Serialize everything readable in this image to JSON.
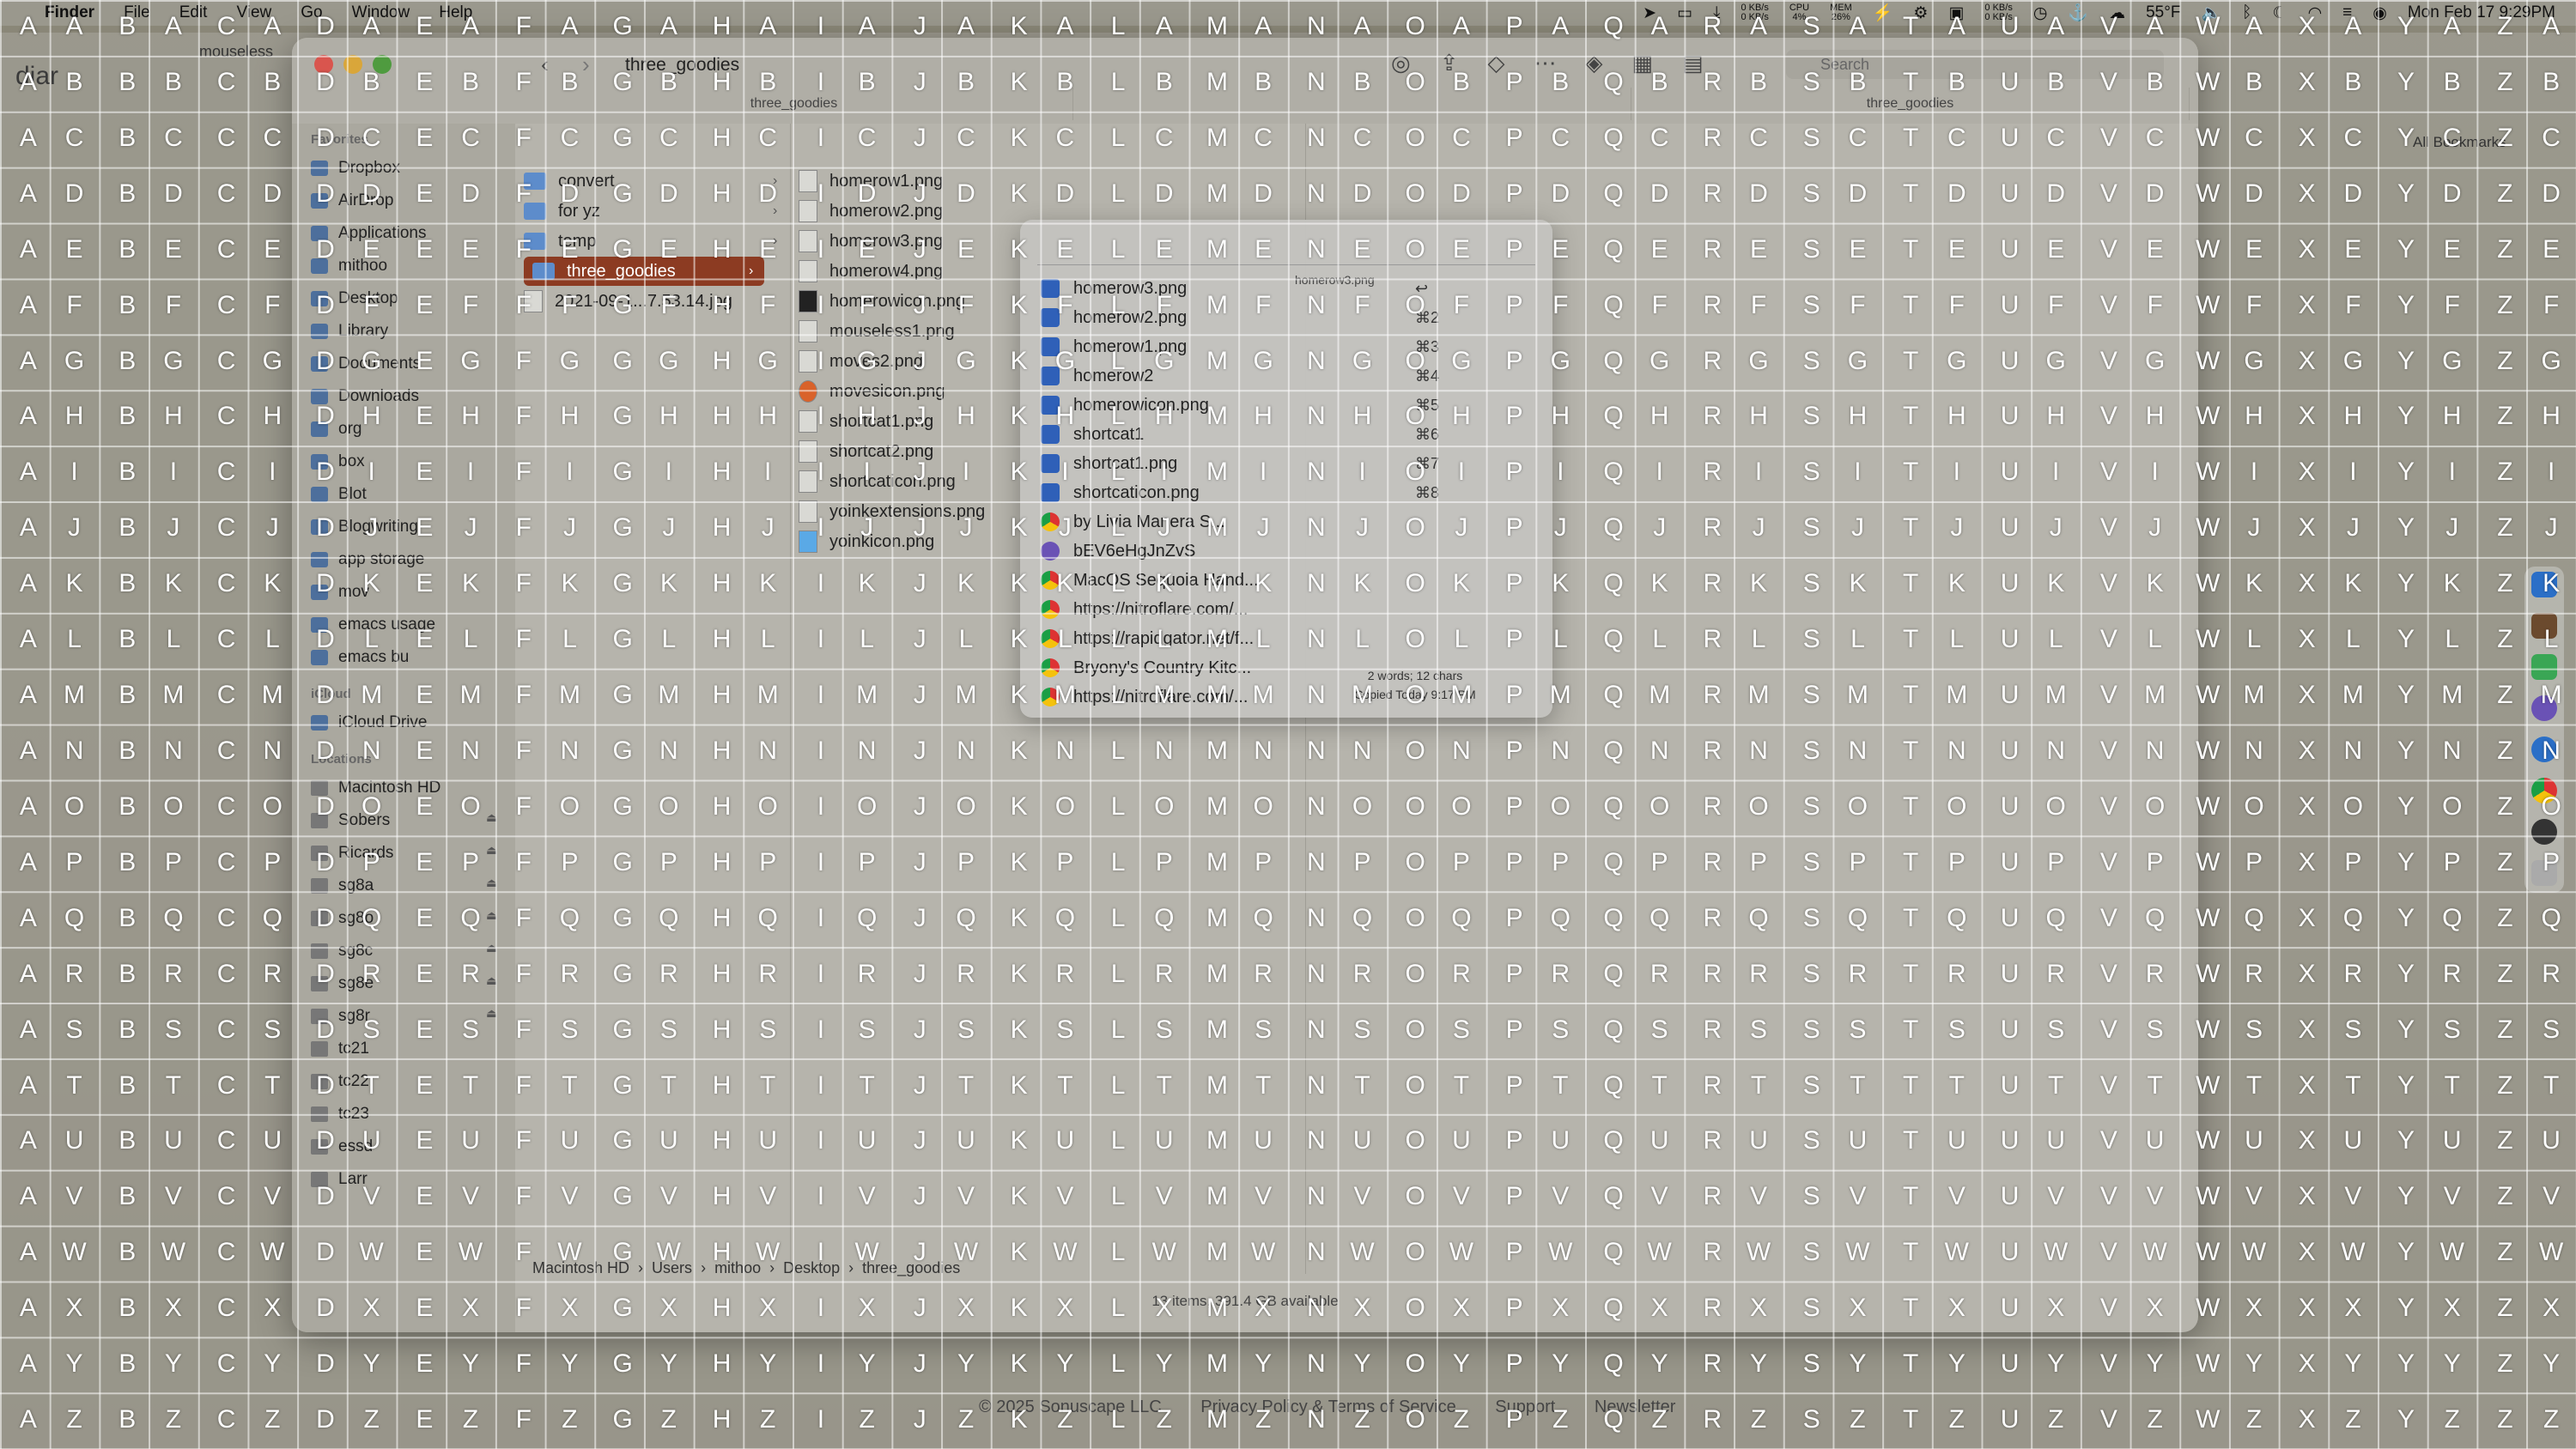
{
  "menubar": {
    "app": "Finder",
    "items": [
      "File",
      "Edit",
      "View",
      "Go",
      "Window",
      "Help"
    ],
    "status": {
      "net_up": "0 KB/s",
      "net_down": "0 KB/s",
      "cpu_label": "CPU",
      "cpu": "4%",
      "mem_label": "MEM",
      "mem": "26%",
      "net2_up": "0 KB/s",
      "net2_down": "0 KB/s",
      "weather": "55°F",
      "clock": "Mon Feb 17  9:29PM"
    }
  },
  "background": {
    "url_text": "diar",
    "tab_text": "mouseless",
    "bookmarks": "All Bookmarks",
    "footer": [
      "© 2025 Sonuscape LLC",
      "Privacy Policy & Terms of Service",
      "Support",
      "Newsletter"
    ]
  },
  "finder": {
    "title": "three_goodies",
    "tabs": [
      "three_goodies",
      "",
      "three_goodies"
    ],
    "search_placeholder": "Search",
    "sidebar": {
      "favorites_header": "Favorites",
      "favorites": [
        "Dropbox",
        "AirDrop",
        "Applications",
        "mithoo",
        "Desktop",
        "Library",
        "Documents",
        "Downloads",
        "org",
        "box",
        "Blot",
        "Blogwriting",
        "app storage",
        "mov",
        "emacs usage",
        "emacs bu"
      ],
      "icloud_header": "iCloud",
      "icloud": [
        "iCloud Drive"
      ],
      "locations_header": "Locations",
      "locations": [
        "Macintosh HD",
        "Sobers",
        "Ricards",
        "sg8a",
        "sg8o",
        "sg8c",
        "sg8e",
        "sg8r",
        "tc21",
        "tc22",
        "tc23",
        "essd",
        "Larr"
      ]
    },
    "column1": [
      {
        "name": "convert",
        "type": "folder"
      },
      {
        "name": "for yz",
        "type": "folder"
      },
      {
        "name": "temp",
        "type": "folder"
      },
      {
        "name": "three_goodies",
        "type": "folder",
        "selected": true
      },
      {
        "name": "2021-09-1...7.53.14.jpg",
        "type": "file"
      }
    ],
    "column2": [
      "homerow1.png",
      "homerow2.png",
      "homerow3.png",
      "homerow4.png",
      "homerowicon.png",
      "mouseless1.png",
      "moves2.png",
      "movesicon.png",
      "shortcat1.png",
      "shortcat2.png",
      "shortcaticon.png",
      "yoinkextensions.png",
      "yoinkicon.png"
    ],
    "pathbar": [
      "Macintosh HD",
      "Users",
      "mithoo",
      "Desktop",
      "three_goodies"
    ],
    "statusbar": "13 items, 391.4 GB available"
  },
  "clipboard_popup": {
    "input_value": "",
    "preview_label": "homerow3.png",
    "preview_info_words": "2 words; 12 chars",
    "preview_info_copied": "Copied Today 9:17 PM",
    "items": [
      {
        "label": "homerow3.png",
        "shortcut": "↩",
        "icon": "image"
      },
      {
        "label": "homerow2.png",
        "shortcut": "⌘2",
        "icon": "image"
      },
      {
        "label": "homerow1.png",
        "shortcut": "⌘3",
        "icon": "image"
      },
      {
        "label": "homerow2",
        "shortcut": "⌘4",
        "icon": "image"
      },
      {
        "label": "homerowicon.png",
        "shortcut": "⌘5",
        "icon": "image"
      },
      {
        "label": "shortcat1",
        "shortcut": "⌘6",
        "icon": "image"
      },
      {
        "label": "shortcat1.png",
        "shortcut": "⌘7",
        "icon": "image"
      },
      {
        "label": "shortcaticon.png",
        "shortcut": "⌘8",
        "icon": "image"
      },
      {
        "label": "by Livia Manera S...",
        "shortcut": "",
        "icon": "chrome"
      },
      {
        "label": "bEV6eHgJnZvS",
        "shortcut": "",
        "icon": "emacs"
      },
      {
        "label": "MacOS Sequoia Hand...",
        "shortcut": "",
        "icon": "chrome"
      },
      {
        "label": "https://nitroflare.com/...",
        "shortcut": "",
        "icon": "chrome"
      },
      {
        "label": "https://rapidgator.net/f...",
        "shortcut": "",
        "icon": "chrome"
      },
      {
        "label": "Bryony's Country Kitc...",
        "shortcut": "",
        "icon": "chrome"
      },
      {
        "label": "https://nitroflare.com/...",
        "shortcut": "",
        "icon": "chrome"
      }
    ]
  },
  "grid_overlay": {
    "columns": [
      "A",
      "B",
      "C",
      "D",
      "E",
      "F",
      "G",
      "H",
      "I",
      "J",
      "K",
      "L",
      "M",
      "N",
      "O",
      "P",
      "Q",
      "R",
      "S",
      "T",
      "U",
      "V",
      "W",
      "X",
      "Y",
      "Z"
    ],
    "rows": [
      "A",
      "B",
      "C",
      "D",
      "E",
      "F",
      "G",
      "H",
      "I",
      "J",
      "K",
      "L",
      "M",
      "N",
      "O",
      "P",
      "Q",
      "R",
      "S",
      "T",
      "U",
      "V",
      "W",
      "X",
      "Y",
      "Z"
    ]
  }
}
